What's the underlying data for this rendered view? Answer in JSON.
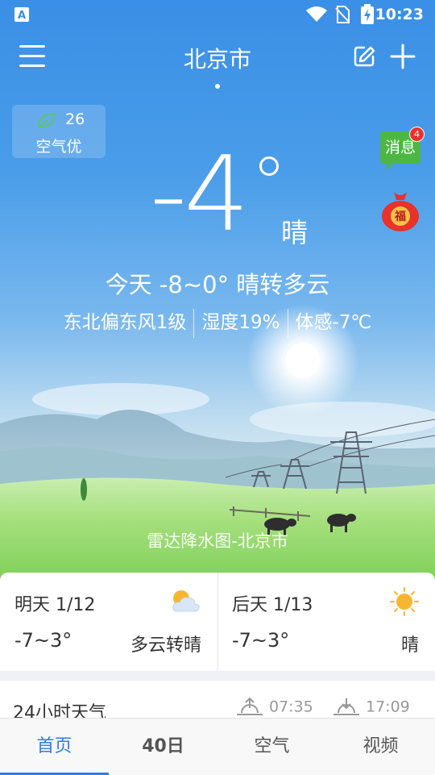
{
  "status_bar": {
    "time": "10:23",
    "left_icon": "a-notification-icon",
    "icons": [
      "wifi-icon",
      "no-sim-icon",
      "battery-charging-icon"
    ]
  },
  "header": {
    "city": "北京市",
    "icons": [
      "menu-icon",
      "edit-icon",
      "add-icon"
    ]
  },
  "aqi": {
    "value": "26",
    "label": "空气优",
    "icon": "leaf-icon"
  },
  "side_widgets": {
    "message_label": "消息",
    "message_count": "4",
    "lucky_bag_label": "福"
  },
  "current": {
    "temperature": "-4",
    "condition": "晴",
    "summary": "今天 -8~0° 晴转多云",
    "wind": "东北偏东风1级",
    "humidity": "湿度19%",
    "feels_like": "体感-7℃"
  },
  "radar_link": "雷达降水图-北京市",
  "forecast": [
    {
      "day": "明天 1/12",
      "range": "-7~3°",
      "desc": "多云转晴",
      "icon": "partly-cloudy-icon"
    },
    {
      "day": "后天 1/13",
      "range": "-7~3°",
      "desc": "晴",
      "icon": "sun-icon"
    }
  ],
  "hourly": {
    "title": "24小时天气",
    "sunrise": "07:35",
    "sunset": "17:09"
  },
  "tabs": [
    "首页",
    "40日",
    "空气",
    "视频"
  ],
  "colors": {
    "accent": "#2b7de9",
    "sky": "#3a8fe6",
    "grass": "#8fd66a"
  }
}
